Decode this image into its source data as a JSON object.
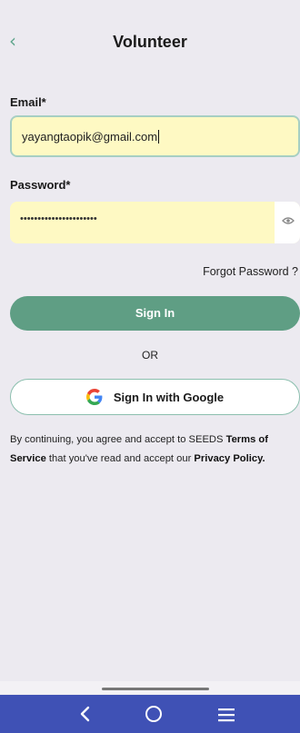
{
  "header": {
    "title": "Volunteer",
    "back_icon": "chevron-left-icon"
  },
  "form": {
    "email_label": "Email*",
    "email_value": "yayangtaopik@gmail.com",
    "password_label": "Password*",
    "password_value": "••••••••••••••••••••••",
    "password_visibility_icon": "eye-icon",
    "forgot_label": "Forgot Password ?",
    "signin_label": "Sign In",
    "or_label": "OR",
    "google_label": "Sign In with Google"
  },
  "terms": {
    "prefix": "By continuing, you agree and accept to SEEDS ",
    "tos_link": "Terms of Service",
    "middle": " that you've read and accept our ",
    "privacy_link": "Privacy Policy."
  },
  "colors": {
    "accent": "#5f9e84",
    "field_bg": "#fef9c3",
    "navbar": "#3f51b5",
    "background": "#eceaf0"
  },
  "navbar": {
    "icons": [
      "back-icon",
      "home-icon",
      "menu-icon"
    ]
  }
}
